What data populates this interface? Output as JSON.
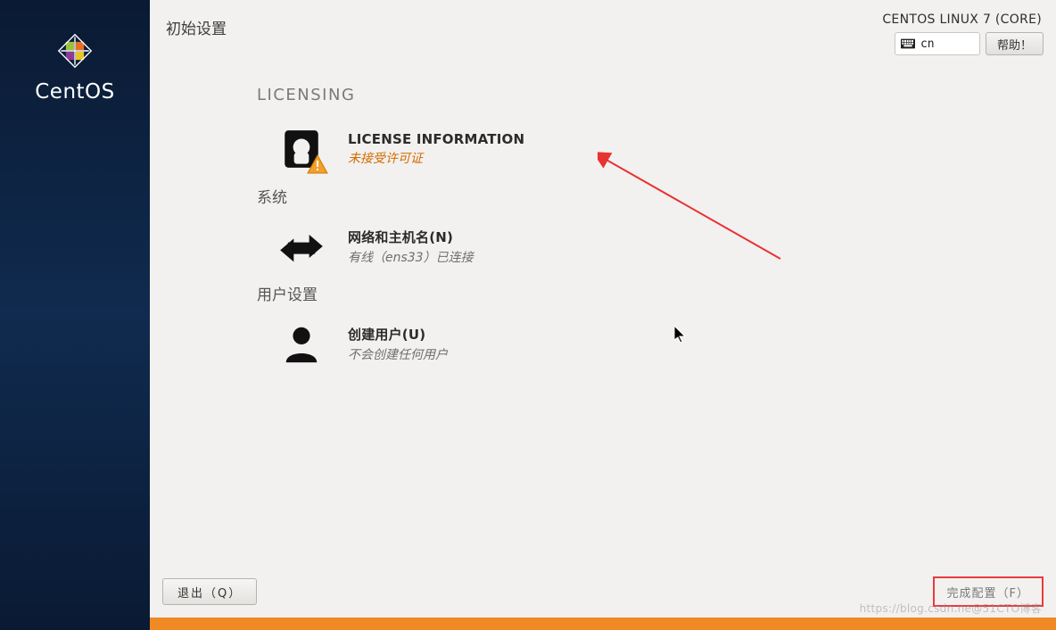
{
  "sidebar": {
    "brand": "CentOS"
  },
  "header": {
    "title": "初始设置",
    "distro": "CENTOS LINUX 7 (CORE)",
    "keyboard_layout": "cn",
    "help_label": "帮助！"
  },
  "sections": {
    "licensing": {
      "heading": "LICENSING",
      "item": {
        "title": "LICENSE INFORMATION",
        "status": "未接受许可证",
        "status_warn": true
      }
    },
    "system": {
      "heading": "系统",
      "network": {
        "title": "网络和主机名(N)",
        "status": "有线（ens33）已连接"
      }
    },
    "users": {
      "heading": "用户设置",
      "create_user": {
        "title": "创建用户(U)",
        "status": "不会创建任何用户"
      }
    }
  },
  "footer": {
    "quit_label": "退出（Q）",
    "finish_label": "完成配置（F）"
  },
  "watermark": "https://blog.csdn.ne@51CTO博客"
}
